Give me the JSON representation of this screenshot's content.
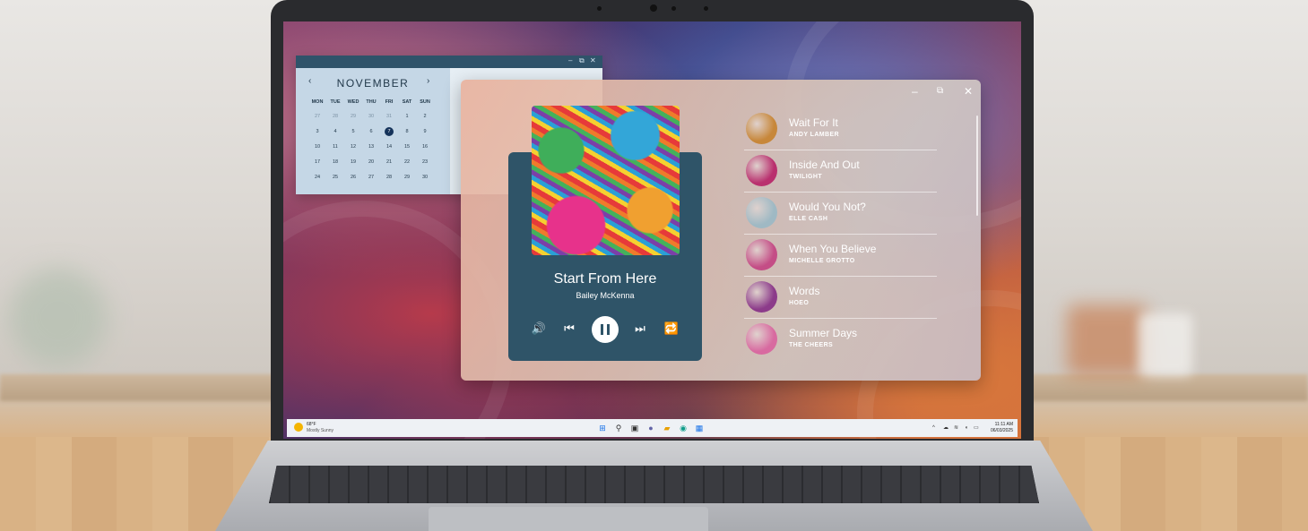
{
  "calendar": {
    "month": "NOVEMBER",
    "prev": "‹",
    "next": "›",
    "window_controls": [
      "–",
      "⧉",
      "✕"
    ],
    "weekdays": [
      "MON",
      "TUE",
      "WED",
      "THU",
      "FRI",
      "SAT",
      "SUN"
    ],
    "weeks": [
      [
        "27",
        "28",
        "29",
        "30",
        "31",
        "1",
        "2"
      ],
      [
        "3",
        "4",
        "5",
        "6",
        "7",
        "8",
        "9"
      ],
      [
        "10",
        "11",
        "12",
        "13",
        "14",
        "15",
        "16"
      ],
      [
        "17",
        "18",
        "19",
        "20",
        "21",
        "22",
        "23"
      ],
      [
        "24",
        "25",
        "26",
        "27",
        "28",
        "29",
        "30"
      ]
    ],
    "selected_day": "7"
  },
  "player": {
    "window_controls": [
      "–",
      "⧉",
      "✕"
    ],
    "now_playing": {
      "title": "Start From Here",
      "artist": "Bailey McKenna"
    },
    "controls": {
      "volume": "🔊",
      "previous": "⏮",
      "next": "⏭",
      "repeat": "🔁"
    },
    "tracks": [
      {
        "title": "Wait For It",
        "artist": "ANDY LAMBER",
        "color": "#c7873a"
      },
      {
        "title": "Inside And Out",
        "artist": "TWILIGHT",
        "color": "#b9306e"
      },
      {
        "title": "Would You Not?",
        "artist": "ELLE CASH",
        "color": "#9fb9c4"
      },
      {
        "title": "When You Believe",
        "artist": "MICHELLE GROTTO",
        "color": "#c44d86"
      },
      {
        "title": "Words",
        "artist": "HOEO",
        "color": "#8c3b8a"
      },
      {
        "title": "Summer Days",
        "artist": "THE CHEERS",
        "color": "#d86aa0"
      }
    ]
  },
  "taskbar": {
    "weather_temp": "68°F",
    "weather_desc": "Mostly Sunny",
    "time": "11:11 AM",
    "date": "06/03/2025",
    "tray_chevron": "^"
  }
}
